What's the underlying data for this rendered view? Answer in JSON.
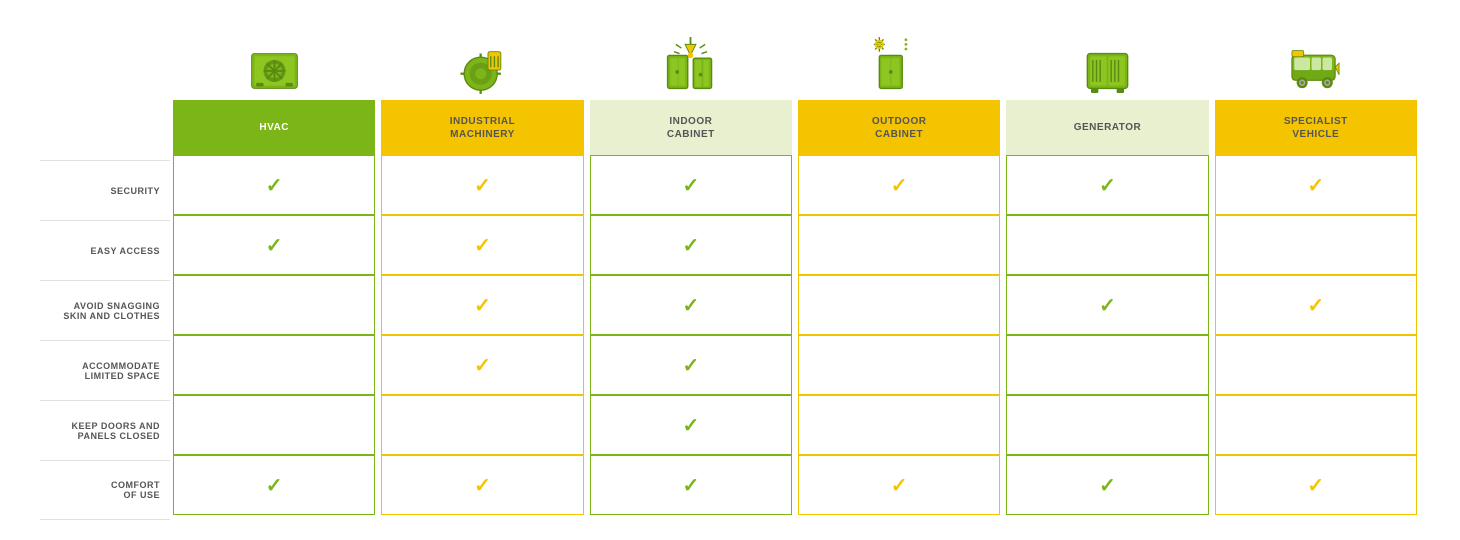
{
  "columns": [
    {
      "id": "hvac",
      "title": "HVAC",
      "titleStyle": "green",
      "borderStyle": "green-border",
      "checkColor": "green",
      "iconType": "hvac"
    },
    {
      "id": "industrial",
      "title": "INDUSTRIAL\nMACHINERY",
      "titleStyle": "yellow",
      "borderStyle": "yellow-border",
      "checkColor": "yellow-check",
      "iconType": "industrial"
    },
    {
      "id": "indoor",
      "title": "INDOOR\nCABINET",
      "titleStyle": "light-green",
      "borderStyle": "green-border",
      "checkColor": "green",
      "iconType": "indoor"
    },
    {
      "id": "outdoor",
      "title": "OUTDOOR\nCABINET",
      "titleStyle": "yellow",
      "borderStyle": "yellow-border",
      "checkColor": "yellow-check",
      "iconType": "outdoor"
    },
    {
      "id": "generator",
      "title": "GENERATOR",
      "titleStyle": "light-green",
      "borderStyle": "green-border",
      "checkColor": "green",
      "iconType": "generator"
    },
    {
      "id": "specialist",
      "title": "SPECIALIST\nVEHICLE",
      "titleStyle": "yellow",
      "borderStyle": "yellow-border",
      "checkColor": "yellow-check",
      "iconType": "specialist"
    }
  ],
  "rows": [
    {
      "label": "SECURITY",
      "checks": [
        true,
        true,
        true,
        true,
        true,
        true
      ]
    },
    {
      "label": "EASY ACCESS",
      "checks": [
        true,
        true,
        true,
        false,
        false,
        false
      ]
    },
    {
      "label": "AVOID SNAGGING\nSKIN AND CLOTHES",
      "checks": [
        false,
        true,
        true,
        false,
        true,
        true
      ]
    },
    {
      "label": "ACCOMMODATE\nLIMITED SPACE",
      "checks": [
        false,
        true,
        true,
        false,
        false,
        false
      ]
    },
    {
      "label": "KEEP DOORS AND\nPANELS CLOSED",
      "checks": [
        false,
        false,
        true,
        false,
        false,
        false
      ]
    },
    {
      "label": "COMFORT\nOF USE",
      "checks": [
        true,
        true,
        true,
        true,
        true,
        true
      ]
    }
  ]
}
